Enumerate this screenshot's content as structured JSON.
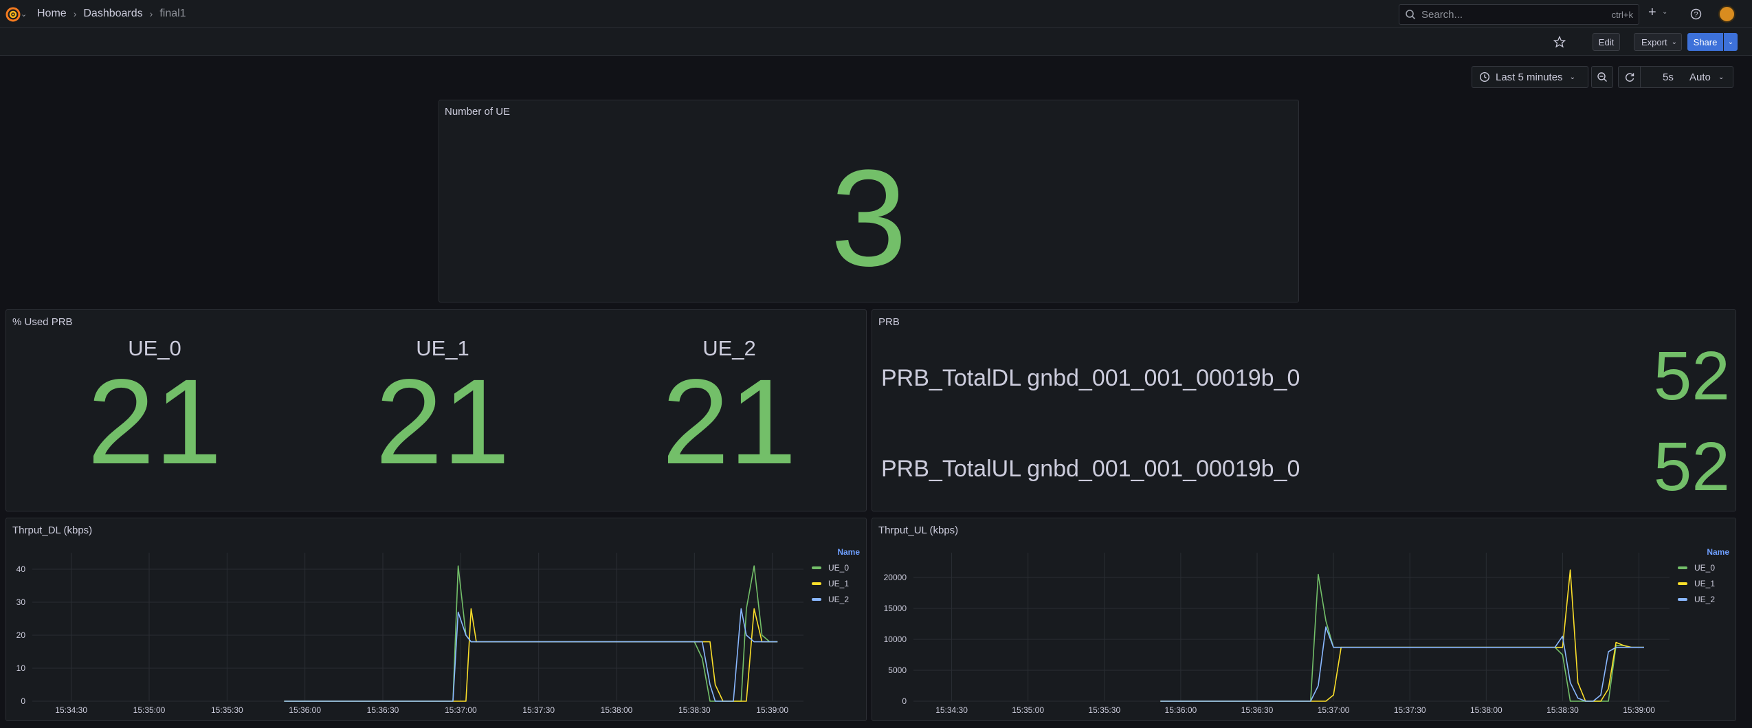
{
  "breadcrumb": {
    "home": "Home",
    "dashboards": "Dashboards",
    "current": "final1"
  },
  "search": {
    "placeholder": "Search...",
    "shortcut": "ctrl+k"
  },
  "toolbar": {
    "edit": "Edit",
    "export": "Export",
    "share": "Share"
  },
  "time": {
    "range": "Last 5 minutes",
    "refresh": "5s",
    "mode": "Auto"
  },
  "colors": {
    "green": "#73bf69",
    "yellow": "#fade2a",
    "blue": "#8ab8ff",
    "accent": "#3d71d9"
  },
  "panels": {
    "num_ue": {
      "title": "Number of UE",
      "value": "3"
    },
    "used_prb": {
      "title": "% Used PRB",
      "stats": [
        {
          "label": "UE_0",
          "value": "21"
        },
        {
          "label": "UE_1",
          "value": "21"
        },
        {
          "label": "UE_2",
          "value": "21"
        }
      ]
    },
    "prb": {
      "title": "PRB",
      "rows": [
        {
          "label": "PRB_TotalDL gnbd_001_001_00019b_0",
          "value": "52"
        },
        {
          "label": "PRB_TotalUL gnbd_001_001_00019b_0",
          "value": "52"
        }
      ]
    },
    "dl": {
      "title": "Thrput_DL (kbps)",
      "legend_head": "Name"
    },
    "ul": {
      "title": "Thrput_UL (kbps)",
      "legend_head": "Name"
    }
  },
  "chart_data": [
    {
      "type": "line",
      "title": "Thrput_DL (kbps)",
      "x_ticks": [
        "15:34:30",
        "15:35:00",
        "15:35:30",
        "15:36:00",
        "15:36:30",
        "15:37:00",
        "15:37:30",
        "15:38:00",
        "15:38:30",
        "15:39:00"
      ],
      "ylim": [
        0,
        45
      ],
      "y_ticks": [
        0,
        10,
        20,
        30,
        40
      ],
      "grid": true,
      "legend": "right",
      "x": [
        "15:35:52",
        "15:36:57",
        "15:36:59",
        "15:37:02",
        "15:37:04",
        "15:37:06",
        "15:38:30",
        "15:38:33",
        "15:38:36",
        "15:38:38",
        "15:38:41",
        "15:38:45",
        "15:38:48",
        "15:38:50",
        "15:38:53",
        "15:38:56",
        "15:38:59",
        "15:39:02"
      ],
      "series": [
        {
          "name": "UE_0",
          "color": "#73bf69",
          "values": [
            0,
            0,
            41,
            20,
            18,
            18,
            18,
            13,
            0,
            0,
            0,
            0,
            0,
            28,
            41,
            20,
            18,
            18
          ]
        },
        {
          "name": "UE_1",
          "color": "#fade2a",
          "values": [
            0,
            0,
            0,
            0,
            28,
            18,
            18,
            18,
            18,
            5,
            0,
            0,
            0,
            0,
            28,
            18,
            18,
            18
          ]
        },
        {
          "name": "UE_2",
          "color": "#8ab8ff",
          "values": [
            0,
            0,
            27,
            20,
            18,
            18,
            18,
            18,
            5,
            0,
            0,
            0,
            28,
            20,
            18,
            18,
            18,
            18
          ]
        }
      ]
    },
    {
      "type": "line",
      "title": "Thrput_UL (kbps)",
      "x_ticks": [
        "15:34:30",
        "15:35:00",
        "15:35:30",
        "15:36:00",
        "15:36:30",
        "15:37:00",
        "15:37:30",
        "15:38:00",
        "15:38:30",
        "15:39:00"
      ],
      "ylim": [
        0,
        24000
      ],
      "y_ticks": [
        0,
        5000,
        10000,
        15000,
        20000
      ],
      "grid": true,
      "legend": "right",
      "x": [
        "15:35:52",
        "15:36:51",
        "15:36:54",
        "15:36:57",
        "15:37:00",
        "15:37:03",
        "15:38:27",
        "15:38:30",
        "15:38:33",
        "15:38:36",
        "15:38:39",
        "15:38:42",
        "15:38:45",
        "15:38:48",
        "15:38:51",
        "15:38:54",
        "15:38:57",
        "15:39:02"
      ],
      "series": [
        {
          "name": "UE_0",
          "color": "#73bf69",
          "values": [
            0,
            0,
            20500,
            13000,
            8700,
            8700,
            8700,
            7500,
            0,
            0,
            0,
            0,
            0,
            0,
            9000,
            9000,
            8700,
            8700
          ]
        },
        {
          "name": "UE_1",
          "color": "#fade2a",
          "values": [
            0,
            0,
            0,
            0,
            1000,
            8700,
            8700,
            8700,
            21200,
            3000,
            0,
            0,
            0,
            2000,
            9500,
            9000,
            8700,
            8700
          ]
        },
        {
          "name": "UE_2",
          "color": "#8ab8ff",
          "values": [
            0,
            0,
            2500,
            12000,
            8700,
            8700,
            8700,
            10500,
            3000,
            500,
            0,
            0,
            1000,
            8000,
            8700,
            8700,
            8700,
            8700
          ]
        }
      ]
    }
  ]
}
